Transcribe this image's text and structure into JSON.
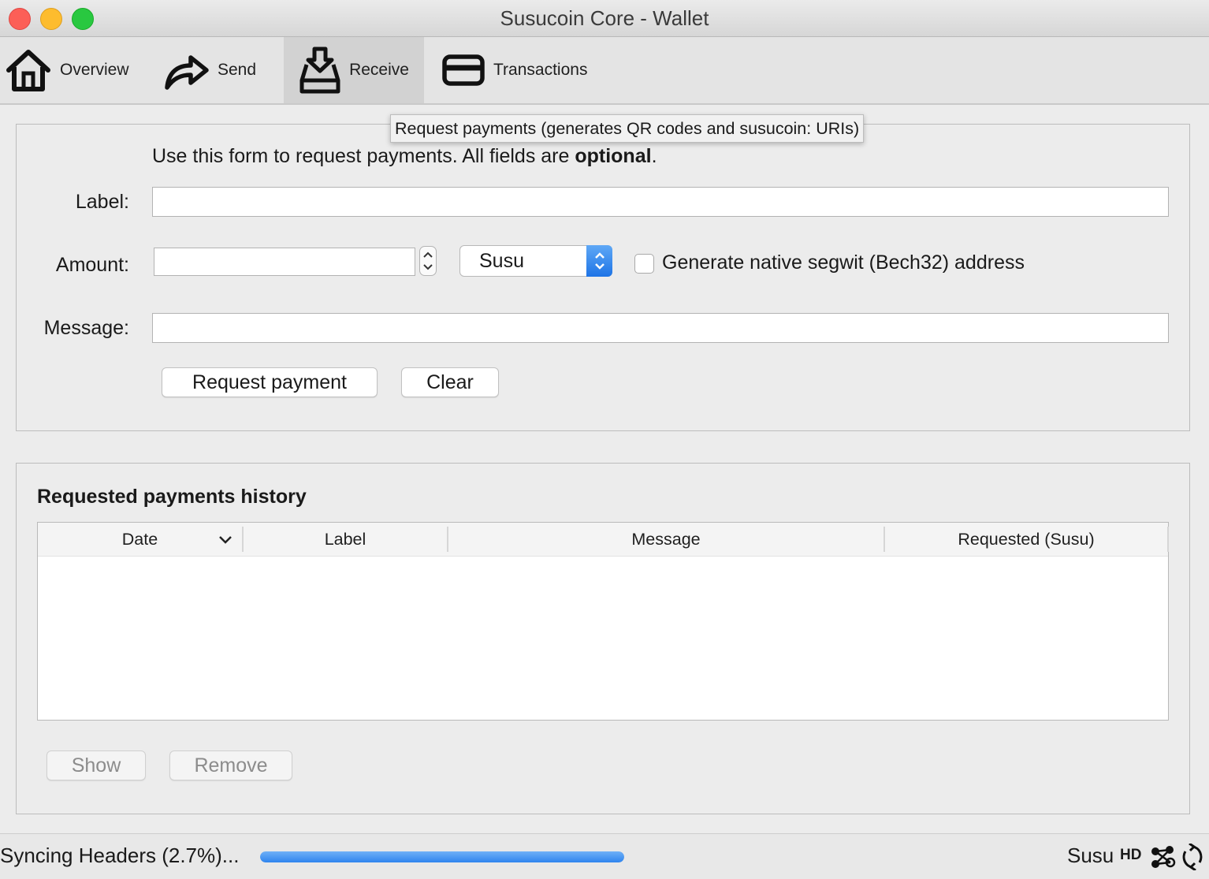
{
  "window": {
    "title": "Susucoin Core - Wallet"
  },
  "toolbar": {
    "overview": "Overview",
    "send": "Send",
    "receive": "Receive",
    "transactions": "Transactions",
    "active": "receive"
  },
  "tooltip": "Request payments (generates QR codes and susucoin: URIs)",
  "form": {
    "intro_prefix": "Use this form to request payments. All fields are ",
    "intro_bold": "optional",
    "intro_suffix": ".",
    "label_label": "Label:",
    "label_value": "",
    "amount_label": "Amount:",
    "amount_value": "",
    "unit_selected": "Susu",
    "segwit_label": "Generate native segwit (Bech32) address",
    "segwit_checked": false,
    "message_label": "Message:",
    "message_value": "",
    "request_button": "Request payment",
    "clear_button": "Clear"
  },
  "history": {
    "title": "Requested payments history",
    "columns": [
      "Date",
      "Label",
      "Message",
      "Requested (Susu)"
    ],
    "rows": [],
    "show_button": "Show",
    "remove_button": "Remove"
  },
  "status": {
    "sync_text": "Syncing Headers (2.7%)...",
    "progress_fraction": 1.0,
    "unit": "Susu",
    "hd": "HD"
  },
  "colors": {
    "accent": "#2f84ee",
    "close": "#fc5f57",
    "minimize": "#fdbc2e",
    "maximize": "#29c840"
  }
}
